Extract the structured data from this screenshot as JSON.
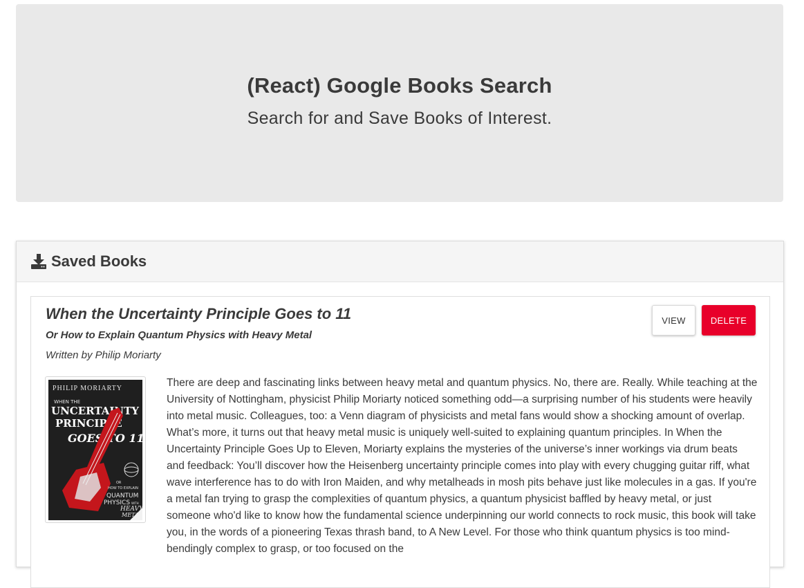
{
  "header": {
    "title": "(React) Google Books Search",
    "subtitle": "Search for and Save Books of Interest."
  },
  "saved": {
    "heading": "Saved Books",
    "icon": "download-icon"
  },
  "book": {
    "title": "When the Uncertainty Principle Goes to 11",
    "subtitle": "Or How to Explain Quantum Physics with Heavy Metal",
    "author": "Written by Philip Moriarty",
    "view_label": "VIEW",
    "delete_label": "DELETE",
    "cover": {
      "author_text": "PHILIP MORIARTY",
      "line1": "WHEN THE",
      "line2": "UNCERTAINTY",
      "line3": "PRINCIPLE",
      "line4": "GOES TO 11",
      "lower1": "OR",
      "lower2": "HOW TO EXPLAIN",
      "lower3": "QUANTUM",
      "lower4": "PHYSICS",
      "lower5": "WITH",
      "lower6": "HEAVY",
      "lower7": "METAL"
    },
    "description": "There are deep and fascinating links between heavy metal and quantum physics. No, there are. Really. While teaching at the University of Nottingham, physicist Philip Moriarty noticed something odd—a surprising number of his students were heavily into metal music. Colleagues, too: a Venn diagram of physicists and metal fans would show a shocking amount of overlap. What’s more, it turns out that heavy metal music is uniquely well-suited to explaining quantum principles. In When the Uncertainty Principle Goes Up to Eleven, Moriarty explains the mysteries of the universe’s inner workings via drum beats and feedback: You’ll discover how the Heisenberg uncertainty principle comes into play with every chugging guitar riff, what wave interference has to do with Iron Maiden, and why metalheads in mosh pits behave just like molecules in a gas. If you're a metal fan trying to grasp the complexities of quantum physics, a quantum physicist baffled by heavy metal, or just someone who'd like to know how the fundamental science underpinning our world connects to rock music, this book will take you, in the words of a pioneering Texas thrash band, to A New Level. For those who think quantum physics is too mind-bendingly complex to grasp, or too focused on the"
  },
  "colors": {
    "jumbotron_bg": "#e9e9e9",
    "delete_red": "#e8002a",
    "cover_bg": "#1f1f1f",
    "guitar_red": "#c4161c"
  }
}
